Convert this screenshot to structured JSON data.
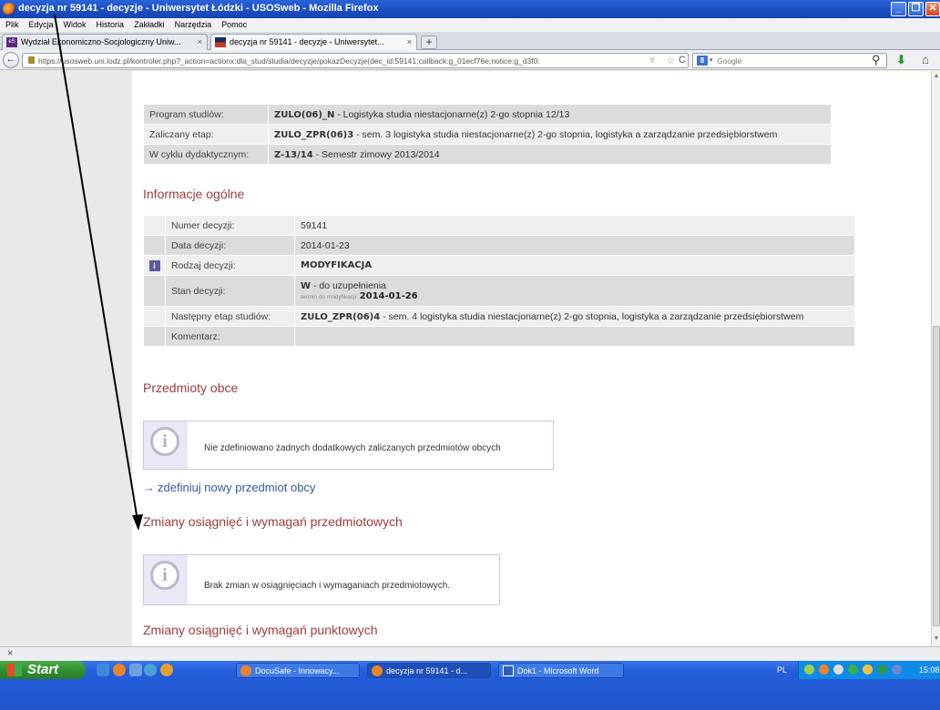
{
  "window": {
    "title": "decyzja nr 59141 - decyzje - Uniwersytet Łódzki - USOSweb - Mozilla Firefox",
    "minimize": "_",
    "maximize": "❐",
    "close": "✕"
  },
  "menu": [
    "Plik",
    "Edycja",
    "Widok",
    "Historia",
    "Zakładki",
    "Narzędzia",
    "Pomoc"
  ],
  "tabs": [
    {
      "label": "Wydział Ekonomiczno-Socjologiczny Uniw...",
      "close": "×"
    },
    {
      "label": "decyzja nr 59141 - decyzje - Uniwersytet...",
      "close": "×"
    }
  ],
  "new_tab": "+",
  "nav": {
    "back": "←",
    "url": "https://usosweb.uni.lodz.pl/kontroler.php?_action=actionx:dla_stud/studia/decyzje/pokazDecyzje(dec_id:59141;callback:g_01ecf76e;notice:g_d3f0:",
    "star": "☆",
    "dropdown": "▿",
    "reload": "C",
    "search_engine": "8",
    "search_dropdown": "▾",
    "search_placeholder": "Google"
  },
  "program": [
    {
      "label": "Program studiów:",
      "code": "ZULO(06)_N",
      "text": " - Logistyka studia niestacjonarne(z) 2-go stopnia 12/13"
    },
    {
      "label": "Zaliczany etap:",
      "code": "ZULO_ZPR(06)3",
      "text": " - sem. 3 logistyka studia niestacjonarne(z) 2-go stopnia, logistyka a zarządzanie przedsiębiorstwem"
    },
    {
      "label": "W cyklu dydaktycznym:",
      "code": "Z-13/14",
      "text": " - Semestr zimowy 2013/2014"
    }
  ],
  "info_heading": "Informacje ogólne",
  "info": {
    "numer_label": "Numer decyzji:",
    "numer_value": "59141",
    "data_label": "Data decyzji:",
    "data_value": "2014-01-23",
    "rodzaj_label": "Rodzaj decyzji:",
    "rodzaj_value": "MODYFIKACJA",
    "rodzaj_icon": "i",
    "stan_label": "Stan decyzji:",
    "stan_code": "W",
    "stan_text": " - do uzupełnienia",
    "stan_sub_label": "termin do modyfikacji:",
    "stan_sub_date": "2014-01-26",
    "etap_label": "Następny etap studiów:",
    "etap_code": "ZULO_ZPR(06)4",
    "etap_text": " - sem. 4 logistyka studia niestacjonarne(z) 2-go stopnia, logistyka a zarządzanie przedsiębiorstwem",
    "komentarz_label": "Komentarz:",
    "komentarz_value": ""
  },
  "obce_heading": "Przedmioty obce",
  "obce_notice": "Nie zdefiniowano żadnych dodatkowych zaliczanych przedmiotów obcych",
  "obce_link_arrow": "→",
  "obce_link": "zdefiniuj nowy przedmiot obcy",
  "osiag_heading": "Zmiany osiągnięć i wymagań przedmiotowych",
  "osiag_notice": "Brak zmian w osiągnięciach i wymaganiach przedmiotowych.",
  "punkt_heading": "Zmiany osiągnięć i wymagań punktowych",
  "notice_icon": "i",
  "findbar_close": "×",
  "taskbar": {
    "start": "Start",
    "buttons": [
      "DocuSafe - Innowacy...",
      "decyzja nr 59141 - d...",
      "Dok1 - Microsoft Word"
    ],
    "lang": "PL",
    "clock": "15:08"
  }
}
